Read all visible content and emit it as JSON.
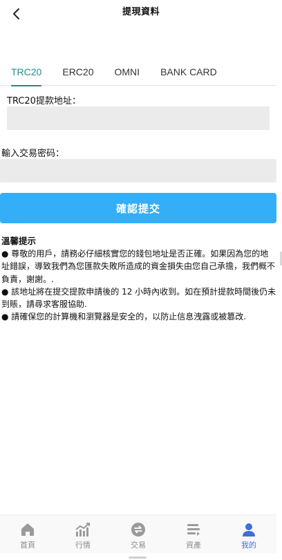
{
  "header": {
    "title": "提現資料",
    "back_icon": "chevron-left-icon"
  },
  "tabs": [
    {
      "label": "TRC20",
      "active": true
    },
    {
      "label": "ERC20",
      "active": false
    },
    {
      "label": "OMNI",
      "active": false
    },
    {
      "label": "BANK CARD",
      "active": false
    }
  ],
  "form": {
    "address_label": "TRC20提款地址：",
    "address_value": "",
    "password_label": "輸入交易密码：",
    "password_value": "",
    "submit_label": "確認提交"
  },
  "tips": {
    "title": "溫馨提示",
    "items": [
      "● 尊敬的用戶，請務必仔細核實您的錢包地址是否正確。如果因為您的地址錯誤，導致我們為您匯款失敗所造成的資金損失由您自己承擔，我們概不負責，謝謝。.",
      "● 該地址將在提交提款申請後的 12 小時內收到。如在預計提款時間後仍未到賬，請尋求客服協助.",
      "● 請確保您的計算機和瀏覽器是安全的，以防止信息洩露或被篡改."
    ]
  },
  "bottom_nav": [
    {
      "label": "首頁",
      "icon": "home-icon",
      "active": false
    },
    {
      "label": "行情",
      "icon": "chart-icon",
      "active": false
    },
    {
      "label": "交易",
      "icon": "exchange-icon",
      "active": false
    },
    {
      "label": "資產",
      "icon": "wallet-icon",
      "active": false
    },
    {
      "label": "我的",
      "icon": "user-icon",
      "active": true
    }
  ],
  "colors": {
    "accent_tab": "#1f8f86",
    "button": "#35aef8",
    "nav_active": "#3d6fd6",
    "nav_inactive": "#8a8a8a"
  }
}
